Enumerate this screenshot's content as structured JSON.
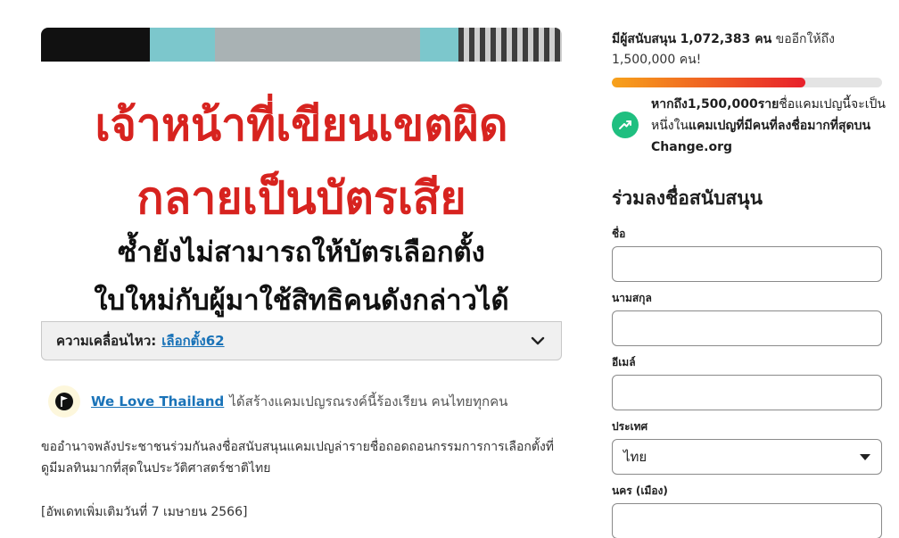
{
  "hero": {
    "line1": "เจ้าหน้าที่เขียนเขตผิด",
    "line2": "กลายเป็นบัตรเสีย",
    "line3": "ซ้ำยังไม่สามารถให้บัตรเลือกตั้ง",
    "line4": "ใบใหม่กับผู้มาใช้สิทธิคนดังกล่าวได้"
  },
  "movement": {
    "label": "ความเคลื่อนไหว:",
    "link": "เลือกตั้ง62"
  },
  "creator": {
    "name": "We Love Thailand",
    "text": "ได้สร้างแคมเปญรณรงค์นี้ร้องเรียน คนไทยทุกคน"
  },
  "description": {
    "body": "ขออำนาจพลังประชาชนร่วมกันลงชื่อสนับสนุนแคมเปญล่ารายชื่อถอดถอนกรรมการการเลือกตั้งที่ดูมีมลทินมากที่สุดในประวัติศาสตร์ชาติไทย",
    "update": "[อัพเดทเพิ่มเติมวันที่ 7 เมษายน 2566]"
  },
  "signers": {
    "prefix": "มีผู้สนับสนุน",
    "count": "1,072,383 คน",
    "suffix": "ขออีกให้ถึง 1,500,000 คน!",
    "progress_fraction": 0.715
  },
  "goal": {
    "bold1": "หากถึง1,500,000ราย",
    "normal": "ชื่อแคมเปญนี้จะเป็นหนึ่งใน",
    "bold2": "แคมเปญที่มีคนที่ลงชื่อมากที่สุดบน Change.org"
  },
  "form": {
    "title": "ร่วมลงชื่อสนับสนุน",
    "first_name_label": "ชื่อ",
    "last_name_label": "นามสกุล",
    "email_label": "อีเมล์",
    "country_label": "ประเทศ",
    "country_value": "ไทย",
    "city_label": "นคร (เมือง)"
  },
  "colors": {
    "link": "#1a73b8",
    "accent_red": "#d7231f",
    "progress_start": "#f7a21b",
    "progress_end": "#e8202b",
    "goal_icon": "#1fbf80"
  },
  "icons": {
    "movement_toggle": "chevron-down-icon",
    "creator_logo": "flag-icon",
    "goal": "trending-up-icon",
    "country_select": "caret-down-icon"
  }
}
